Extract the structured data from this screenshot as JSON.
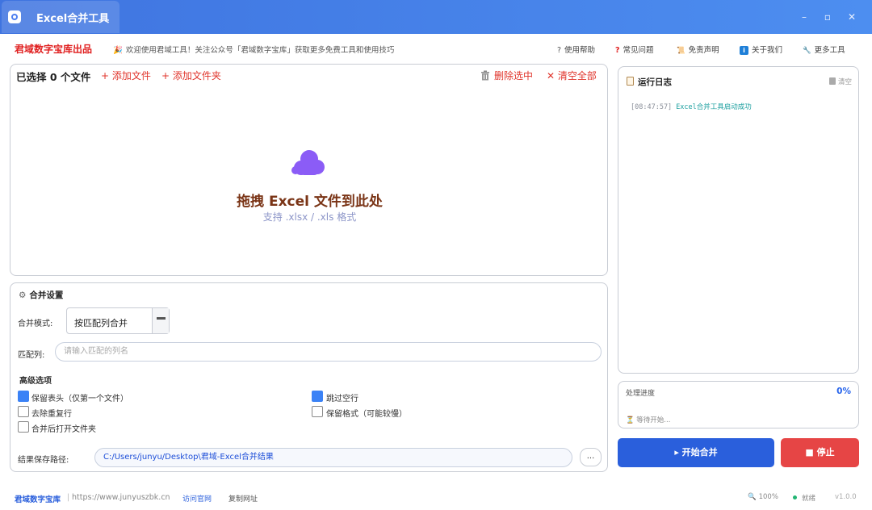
{
  "window": {
    "title": "Excel合并工具",
    "minimize": "–",
    "maximize": "▫",
    "close": "✕"
  },
  "header": {
    "brand": "君域数字宝库出品",
    "notice_icon": "🎉",
    "notice": "欢迎使用君域工具！关注公众号「君域数字宝库」获取更多免费工具和使用技巧",
    "menu": [
      {
        "icon": "?",
        "label": "使用帮助",
        "color": "#555555"
      },
      {
        "icon": "?",
        "label": "常见问题",
        "color": "#e02020"
      },
      {
        "icon": "📜",
        "label": "免责声明",
        "color": "#c08a30"
      },
      {
        "icon": "i",
        "label": "关于我们",
        "color": "#1e7fd8"
      },
      {
        "icon": "🔧",
        "label": "更多工具",
        "color": "#666666"
      }
    ]
  },
  "files": {
    "selected_label": "已选择 0 个文件",
    "add_files": "+ 添加文件",
    "add_folder": "+ 添加文件夹",
    "delete_selected": "删除选中",
    "clear_all": "✕ 清空全部",
    "drop_icon": "cloud-icon",
    "drop_title": "拖拽 Excel 文件到此处",
    "drop_subtitle": "支持 .xlsx / .xls 格式"
  },
  "settings": {
    "title": "合并设置",
    "mode_label": "合并模式:",
    "mode_value": "按匹配列合并",
    "match_label": "匹配列:",
    "match_placeholder": "请输入匹配的列名",
    "advanced_title": "高级选项",
    "options": [
      {
        "label": "保留表头（仅第一个文件）",
        "checked": true
      },
      {
        "label": "跳过空行",
        "checked": true
      },
      {
        "label": "去除重复行",
        "checked": false
      },
      {
        "label": "保留格式（可能较慢）",
        "checked": false
      },
      {
        "label": "合并后打开文件夹",
        "checked": false
      }
    ],
    "path_label": "结果保存路径:",
    "path_value": "C:/Users/junyu/Desktop\\君域-Excel合并结果",
    "browse": "..."
  },
  "log": {
    "title": "运行日志",
    "clear": "清空",
    "entries": [
      {
        "time": "[08:47:57]",
        "message": "Excel合并工具启动成功"
      }
    ]
  },
  "progress": {
    "label": "处理进度",
    "percent": "0%",
    "status": "⏳ 等待开始..."
  },
  "actions": {
    "start": "▸ 开始合并",
    "stop": "■ 停止"
  },
  "footer": {
    "brand": "君域数字宝库",
    "separator": "|",
    "url": "https://www.junyuszbk.cn",
    "visit": "访问官网",
    "copy": "复制网址",
    "zoom": "100%",
    "status": "就绪",
    "version": "v1.0.0"
  },
  "colors": {
    "accent": "#2a5fdc",
    "danger": "#e64545",
    "brand_red": "#e02020",
    "log_text": "#1ea0a0"
  }
}
